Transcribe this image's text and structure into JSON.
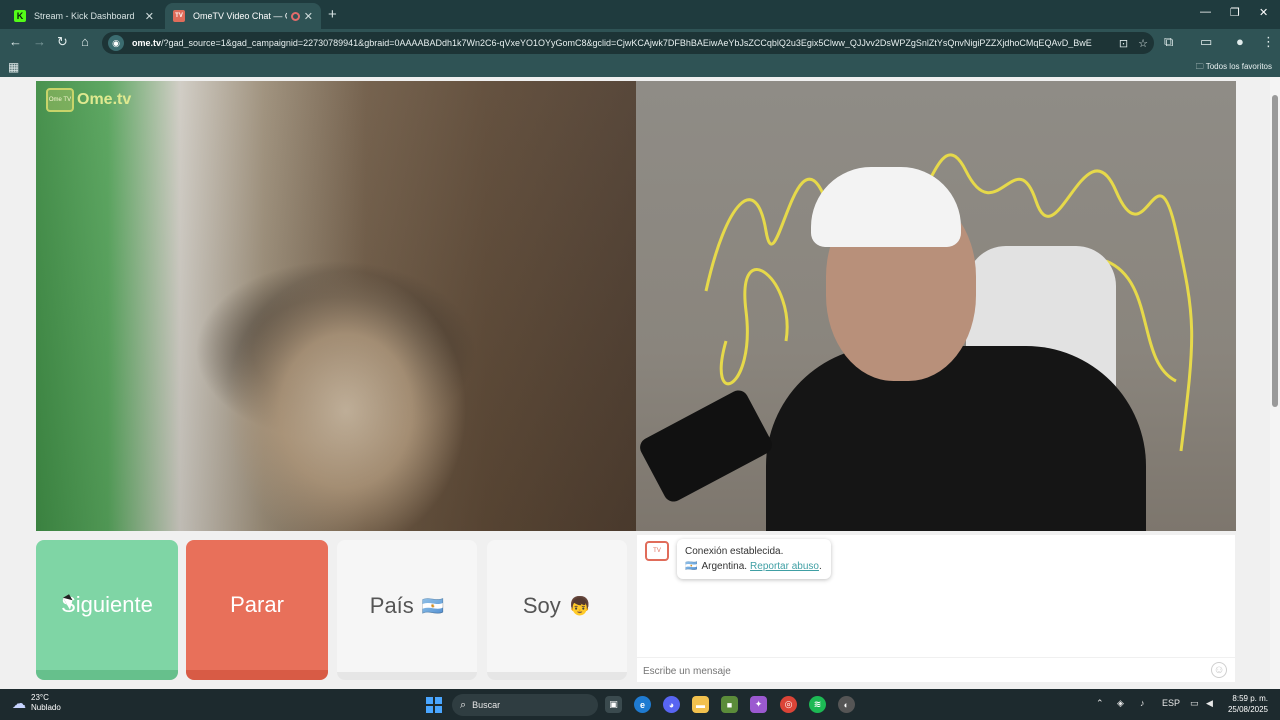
{
  "browser": {
    "tabs": [
      {
        "title": "Stream - Kick Dashboard",
        "favicon": "K",
        "active": false
      },
      {
        "title": "OmeTV Video Chat — Ome",
        "favicon": "TV",
        "active": true
      }
    ],
    "address_bar": {
      "domain": "ome.tv",
      "path": "/?gad_source=1&gad_campaignid=22730789941&gbraid=0AAAABADdh1k7Wn2C6-qVxeYO1OYyGomC8&gclid=CjwKCAjwk7DFBhBAEiwAeYbJsZCCqblQ2u3Egix5Clww_QJJvv2DsWPZgSnlZtYsQnvNigiPZZXjdhoCMqEQAvD_BwE"
    },
    "bookmarks": {
      "all_bookmarks_label": "Todos los favoritos"
    }
  },
  "ometv": {
    "logo_text": "Ome.tv",
    "logo_badge": "Ome TV",
    "buttons": {
      "next": "Siguiente",
      "stop": "Parar",
      "country": "País",
      "country_flag": "🇦🇷",
      "soy": "Soy",
      "soy_emoji": "👦"
    },
    "chat": {
      "system_message": "Conexión establecida.",
      "country_flag": "🇦🇷",
      "country_name": "Argentina.",
      "report_link": "Reportar abuso",
      "report_suffix": ".",
      "input_placeholder": "Escribe un mensaje"
    }
  },
  "taskbar": {
    "weather_temp": "23°C",
    "weather_desc": "Nublado",
    "search_placeholder": "Buscar",
    "language": "ESP",
    "time": "8:59 p. m.",
    "date": "25/08/2025"
  },
  "colors": {
    "next_button": "#7fd5a5",
    "stop_button": "#e8705a",
    "browser_frame": "#2f5355",
    "report_link": "#3f9fa4"
  }
}
